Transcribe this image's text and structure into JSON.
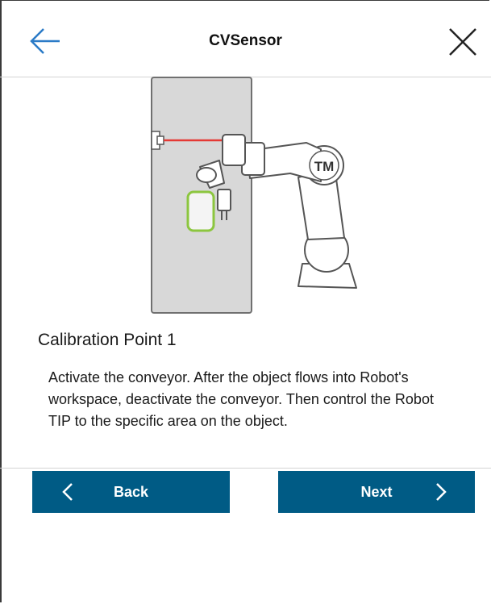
{
  "header": {
    "title": "CVSensor"
  },
  "icons": {
    "back": "left-arrow-icon",
    "close": "close-icon",
    "back_chevron": "chevron-left-icon",
    "next_chevron": "chevron-right-icon"
  },
  "illustration": {
    "logo_text": "TM"
  },
  "step": {
    "title": "Calibration Point 1",
    "description": "Activate the conveyor. After the object flows into Robot's workspace, deactivate the conveyor. Then control the Robot TIP to the specific area on the object."
  },
  "buttons": {
    "back_label": "Back",
    "next_label": "Next"
  },
  "colors": {
    "accent": "#2b7bc7",
    "button": "#005b85",
    "conveyor": "#d8d8d8",
    "object_outline": "#8cc63f",
    "laser": "#e53935"
  }
}
